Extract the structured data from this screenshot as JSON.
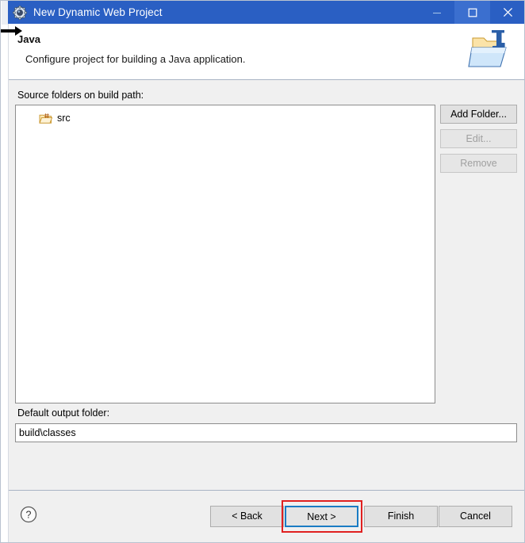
{
  "window": {
    "title": "New Dynamic Web Project",
    "icon": "eclipse-wizard-gear-icon",
    "controls": {
      "minimize": "minimize-icon",
      "maximize": "maximize-icon",
      "close": "close-icon"
    },
    "colors": {
      "titlebar": "#2a5fc3",
      "titlebar_hover": "#3b6fcf",
      "body": "#f0f0f0",
      "focus_border": "#1a7cc4",
      "annotation": "#e02020"
    }
  },
  "header": {
    "title": "Java",
    "subtitle": "Configure project for building a Java application.",
    "icon": "java-folder-wizard-icon"
  },
  "main": {
    "source_folders_label": "Source folders on build path:",
    "folders": [
      {
        "label": "src",
        "icon": "source-folder-icon"
      }
    ],
    "side_buttons": [
      {
        "label": "Add Folder...",
        "enabled": true
      },
      {
        "label": "Edit...",
        "enabled": false
      },
      {
        "label": "Remove",
        "enabled": false
      }
    ],
    "output_folder_label": "Default output folder:",
    "output_folder_value": "build\\classes",
    "output_folder_placeholder": ""
  },
  "footer": {
    "help_icon": "help-circle-icon",
    "buttons": {
      "back": "< Back",
      "next": "Next >",
      "finish": "Finish",
      "cancel": "Cancel"
    }
  }
}
